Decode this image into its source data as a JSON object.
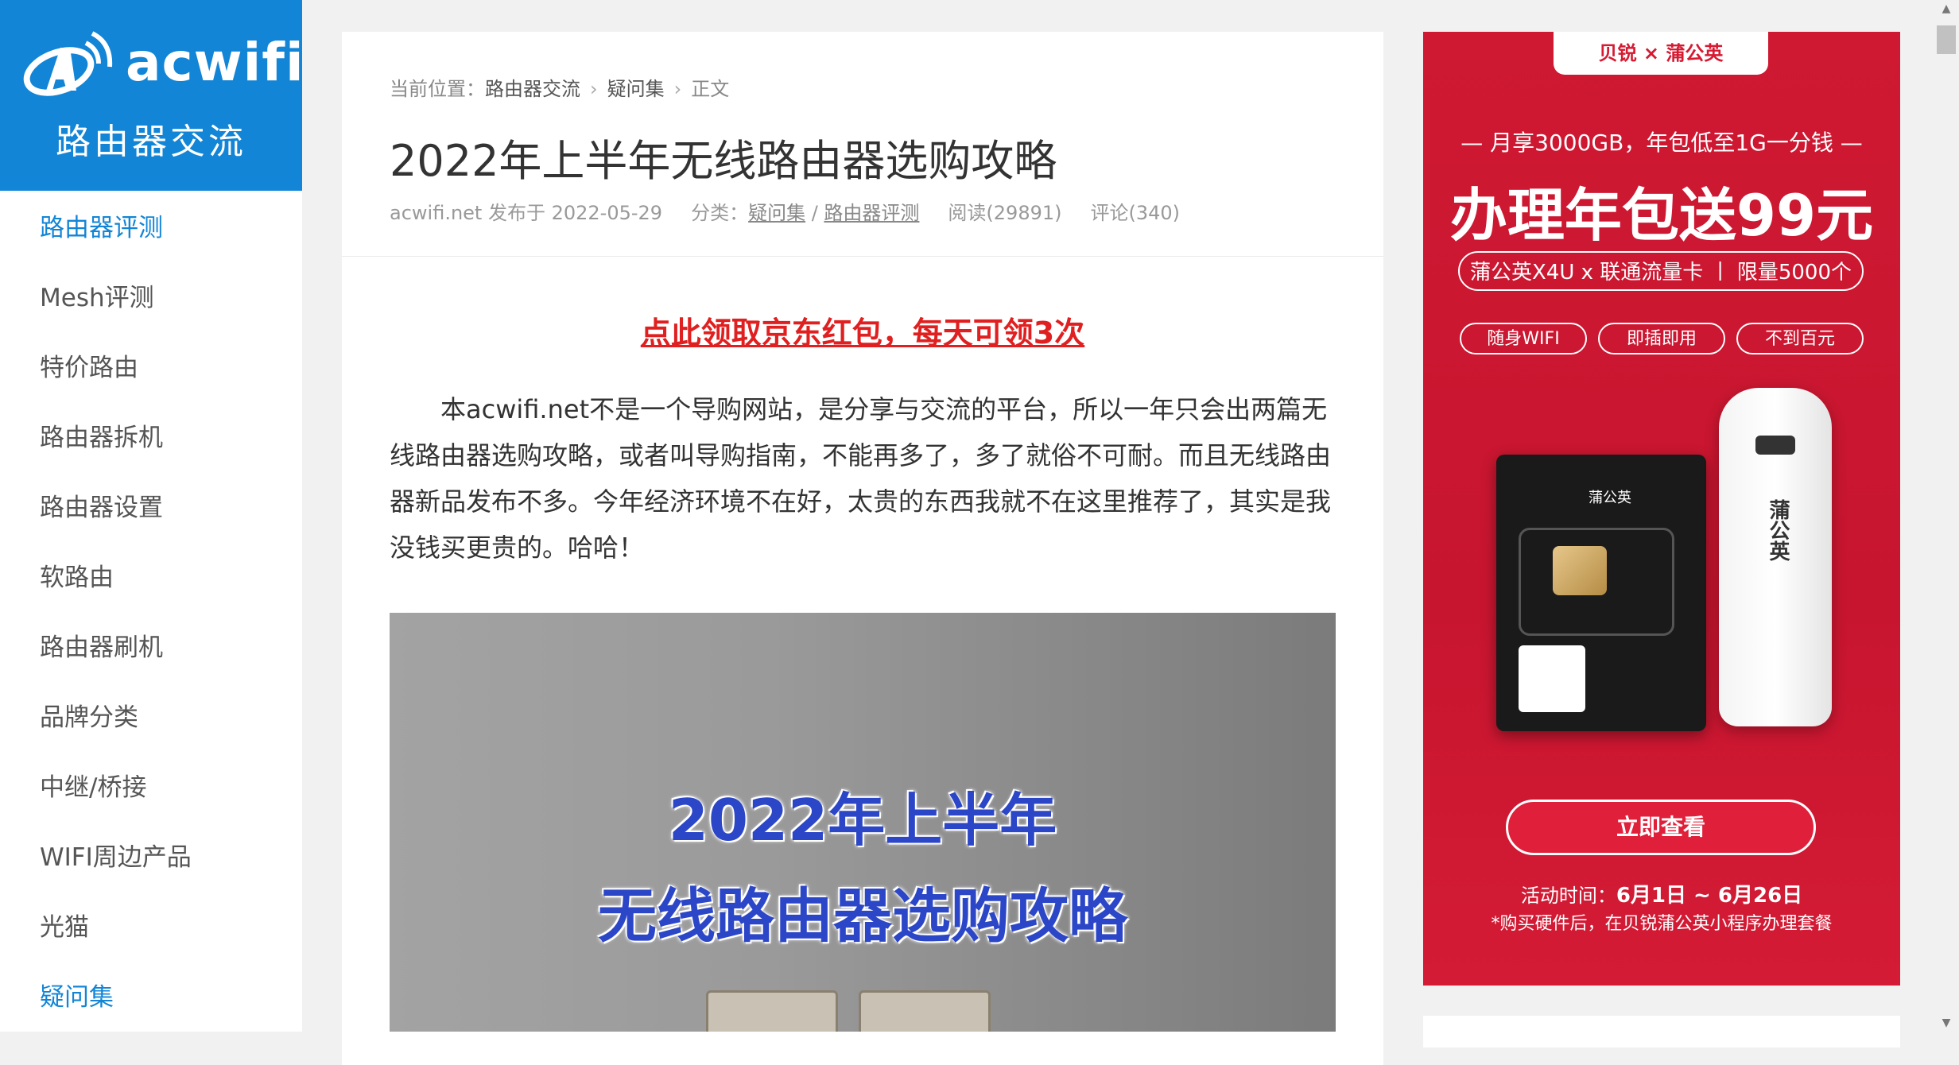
{
  "sidebar": {
    "logo_name": "acwifi",
    "logo_sub": "路由器交流",
    "items": [
      {
        "label": "路由器评测",
        "active": true
      },
      {
        "label": "Mesh评测",
        "active": false
      },
      {
        "label": "特价路由",
        "active": false
      },
      {
        "label": "路由器拆机",
        "active": false
      },
      {
        "label": "路由器设置",
        "active": false
      },
      {
        "label": "软路由",
        "active": false
      },
      {
        "label": "路由器刷机",
        "active": false
      },
      {
        "label": "品牌分类",
        "active": false
      },
      {
        "label": "中继/桥接",
        "active": false
      },
      {
        "label": "WIFI周边产品",
        "active": false
      },
      {
        "label": "光猫",
        "active": false
      },
      {
        "label": "疑问集",
        "active": true
      }
    ]
  },
  "article": {
    "breadcrumb": {
      "prefix": "当前位置：",
      "items": [
        "路由器交流",
        "疑问集",
        "正文"
      ]
    },
    "title": "2022年上半年无线路由器选购攻略",
    "meta": {
      "author_date": "acwifi.net 发布于 2022-05-29",
      "category_label": "分类：",
      "category_1": "疑问集",
      "category_sep": " / ",
      "category_2": "路由器评测",
      "reads": "阅读(29891)",
      "comments": "评论(340)"
    },
    "promo_link": "点此领取京东红包，每天可领3次",
    "paragraph": "本acwifi.net不是一个导购网站，是分享与交流的平台，所以一年只会出两篇无线路由器选购攻略，或者叫导购指南，不能再多了，多了就俗不可耐。而且无线路由器新品发布不多。今年经济环境不在好，太贵的东西我就不在这里推荐了，其实是我没钱买更贵的。哈哈！",
    "hero": {
      "line1": "2022年上半年",
      "line2": "无线路由器选购攻略"
    }
  },
  "ad": {
    "brands": "贝锐 × 蒲公英",
    "line1": "— 月享3000GB，年包低至1G一分钱 —",
    "headline": "办理年包送99元",
    "pill": "蒲公英X4U x 联通流量卡 丨 限量5000个",
    "tags": [
      "随身WIFI",
      "即插即用",
      "不到百元"
    ],
    "sim_brand": "蒲公英",
    "stick_brand": "蒲公英",
    "button": "立即查看",
    "date_label": "活动时间：",
    "date_range": "6月1日 ~ 6月26日",
    "note": "*购买硬件后，在贝锐蒲公英小程序办理套餐"
  },
  "colors": {
    "brand_blue": "#1285d6",
    "promo_red": "#e02020",
    "ad_red": "#cf1933"
  }
}
